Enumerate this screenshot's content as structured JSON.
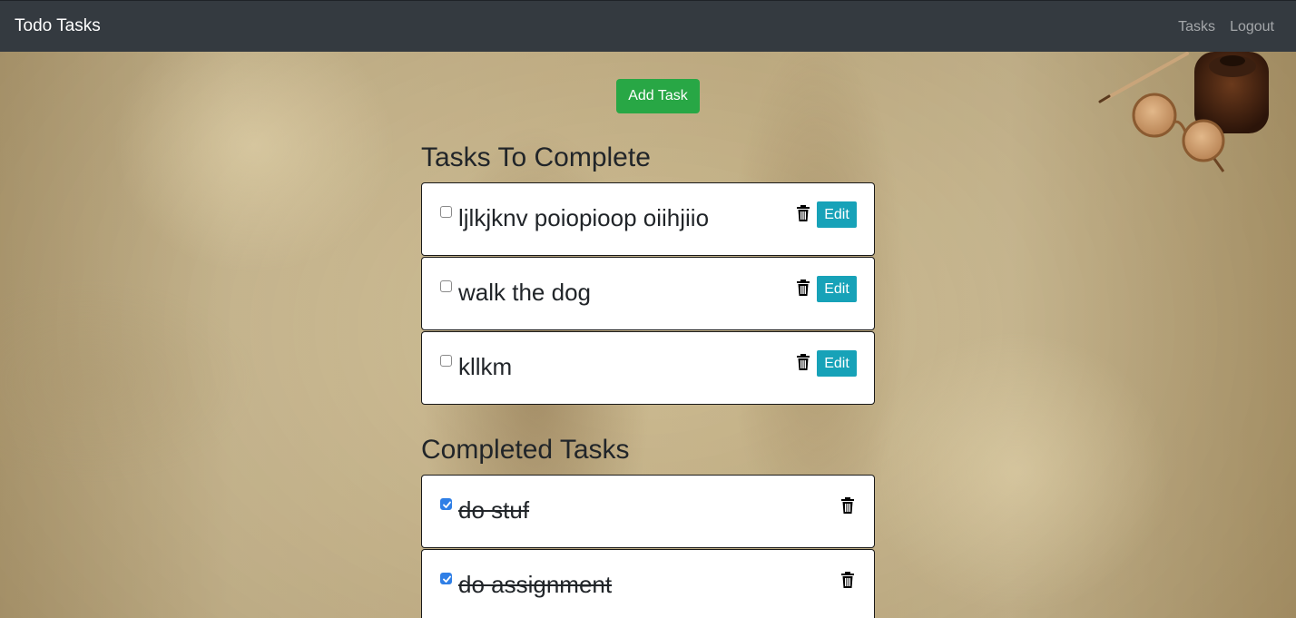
{
  "navbar": {
    "brand": "Todo Tasks",
    "links": [
      "Tasks",
      "Logout"
    ]
  },
  "add_button_label": "Add Task",
  "sections": {
    "todo_title": "Tasks To Complete",
    "completed_title": "Completed Tasks"
  },
  "todo_tasks": [
    {
      "text": "ljlkjknv poiopioop oiihjiio",
      "checked": false
    },
    {
      "text": "walk the dog",
      "checked": false
    },
    {
      "text": "kllkm",
      "checked": false
    }
  ],
  "completed_tasks": [
    {
      "text": "do stuf",
      "checked": true
    },
    {
      "text": "do assignment",
      "checked": true
    }
  ],
  "edit_label": "Edit",
  "colors": {
    "navbar": "#343a40",
    "add_button": "#28a745",
    "edit_button": "#17a2b8",
    "checkbox_checked": "#2f7fe6"
  },
  "icons": {
    "delete": "trash-icon",
    "checkbox": "checkbox-icon"
  }
}
